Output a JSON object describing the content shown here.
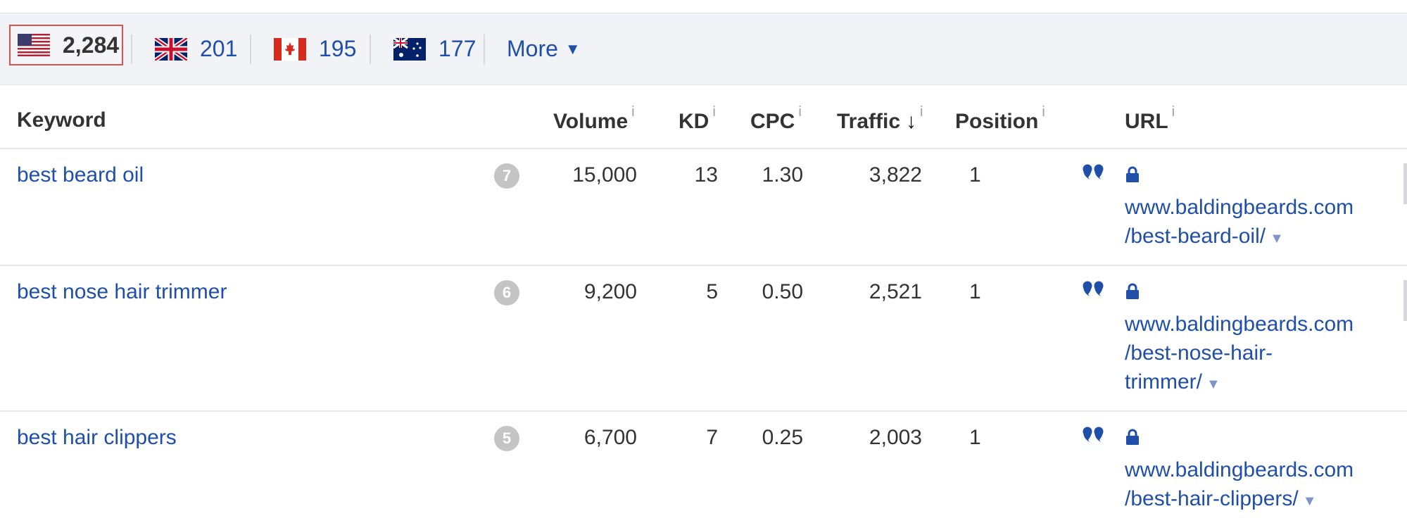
{
  "countries": {
    "us": {
      "count": "2,284"
    },
    "gb": {
      "count": "201"
    },
    "ca": {
      "count": "195"
    },
    "au": {
      "count": "177"
    },
    "more_label": "More"
  },
  "table": {
    "headers": {
      "keyword": "Keyword",
      "volume": "Volume",
      "kd": "KD",
      "cpc": "CPC",
      "traffic": "Traffic",
      "position": "Position",
      "url": "URL",
      "info_glyph": "i",
      "sort_glyph": "↓"
    },
    "rows": [
      {
        "keyword": "best beard oil",
        "serp": "7",
        "volume": "15,000",
        "kd": "13",
        "cpc": "1.30",
        "traffic": "3,822",
        "position": "1",
        "url_lines": [
          "www.baldingbeards.com",
          "/best-beard-oil/"
        ]
      },
      {
        "keyword": "best nose hair trimmer",
        "serp": "6",
        "volume": "9,200",
        "kd": "5",
        "cpc": "0.50",
        "traffic": "2,521",
        "position": "1",
        "url_lines": [
          "www.baldingbeards.com",
          "/best-nose-hair-",
          "trimmer/"
        ]
      },
      {
        "keyword": "best hair clippers",
        "serp": "5",
        "volume": "6,700",
        "kd": "7",
        "cpc": "0.25",
        "traffic": "2,003",
        "position": "1",
        "url_lines": [
          "www.baldingbeards.com",
          "/best-hair-clippers/"
        ]
      }
    ]
  },
  "colors": {
    "link": "#1f4fa8",
    "active_border": "#d9534f",
    "badge": "#c4c4c4"
  },
  "icons": {
    "quote": "quote-icon",
    "lock": "lock-icon",
    "caret": "caret-down-icon"
  }
}
